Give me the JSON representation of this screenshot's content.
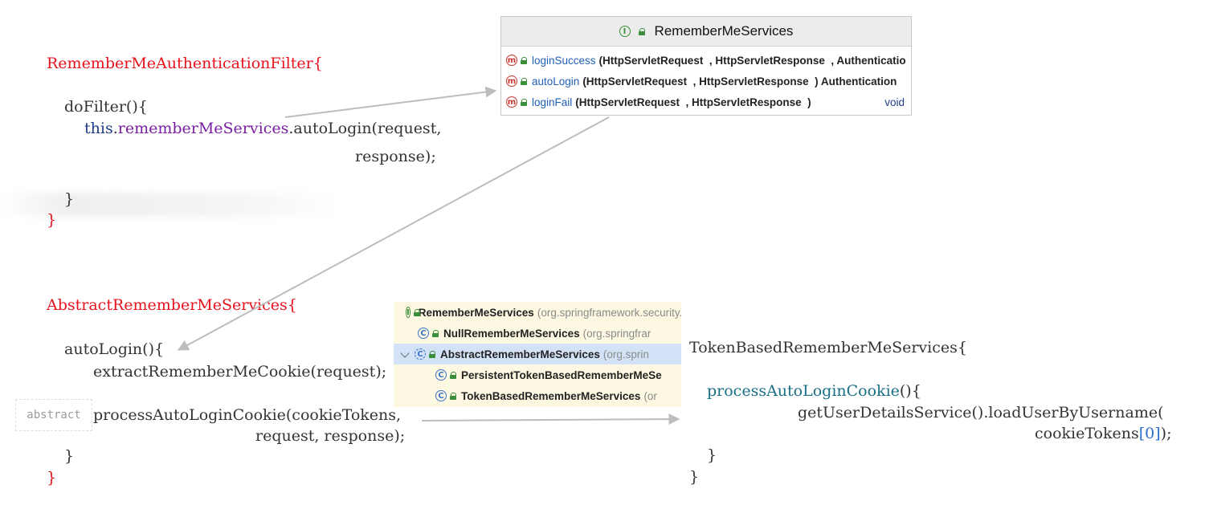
{
  "code_block_1": {
    "class_line": "RememberMeAuthenticationFilter{",
    "method_line": "doFilter(){",
    "call_this": "this",
    "call_dot": ".",
    "call_field": "rememberMeServices",
    "call_rest": ".autoLogin(request,",
    "call_cont": "response);",
    "close_inner": "}",
    "close_outer": "}"
  },
  "code_block_2": {
    "class_line": "AbstractRememberMeServices{",
    "method_line": "autoLogin(){",
    "call_1": "extractRememberMeCookie(request);",
    "call_2": "processAutoLoginCookie(cookieTokens,",
    "call_2_cont": "request, response);",
    "close_inner": "}",
    "close_outer": "}",
    "abstract_tag": "abstract"
  },
  "code_block_3": {
    "class_line": "TokenBasedRememberMeServices{",
    "method_name": "processAutoLoginCookie",
    "method_tail": "(){",
    "call": "getUserDetailsService().loadUserByUsername(",
    "arg_name": "cookieTokens",
    "arg_index": "[0]",
    "arg_tail": ");",
    "close_inner": "}",
    "close_outer": "}"
  },
  "structure_popup": {
    "title": "RememberMeServices",
    "methods": [
      {
        "name": "loginSuccess",
        "params": "(HttpServletRequest  , HttpServletResponse  , Authenticatio",
        "ret": ""
      },
      {
        "name": "autoLogin",
        "params": "(HttpServletRequest  , HttpServletResponse  ) Authentication",
        "ret": ""
      },
      {
        "name": "loginFail",
        "params": "(HttpServletRequest  , HttpServletResponse  )",
        "ret": "void"
      }
    ]
  },
  "hierarchy_popup": {
    "items": [
      {
        "name": "RememberMeServices",
        "pkg": "(org.springframework.security.web.authentication)"
      },
      {
        "name": "NullRememberMeServices",
        "pkg": "(org.springfrar"
      },
      {
        "name": "AbstractRememberMeServices",
        "pkg": "(org.sprin"
      },
      {
        "name": "PersistentTokenBasedRememberMeSe",
        "pkg": ""
      },
      {
        "name": "TokenBasedRememberMeServices",
        "pkg": "(or"
      }
    ]
  },
  "icons": {
    "interface": "interface-icon",
    "method": "method-icon",
    "class": "class-icon",
    "abstract_class": "abstract-class-icon",
    "public": "public-lock-icon"
  }
}
